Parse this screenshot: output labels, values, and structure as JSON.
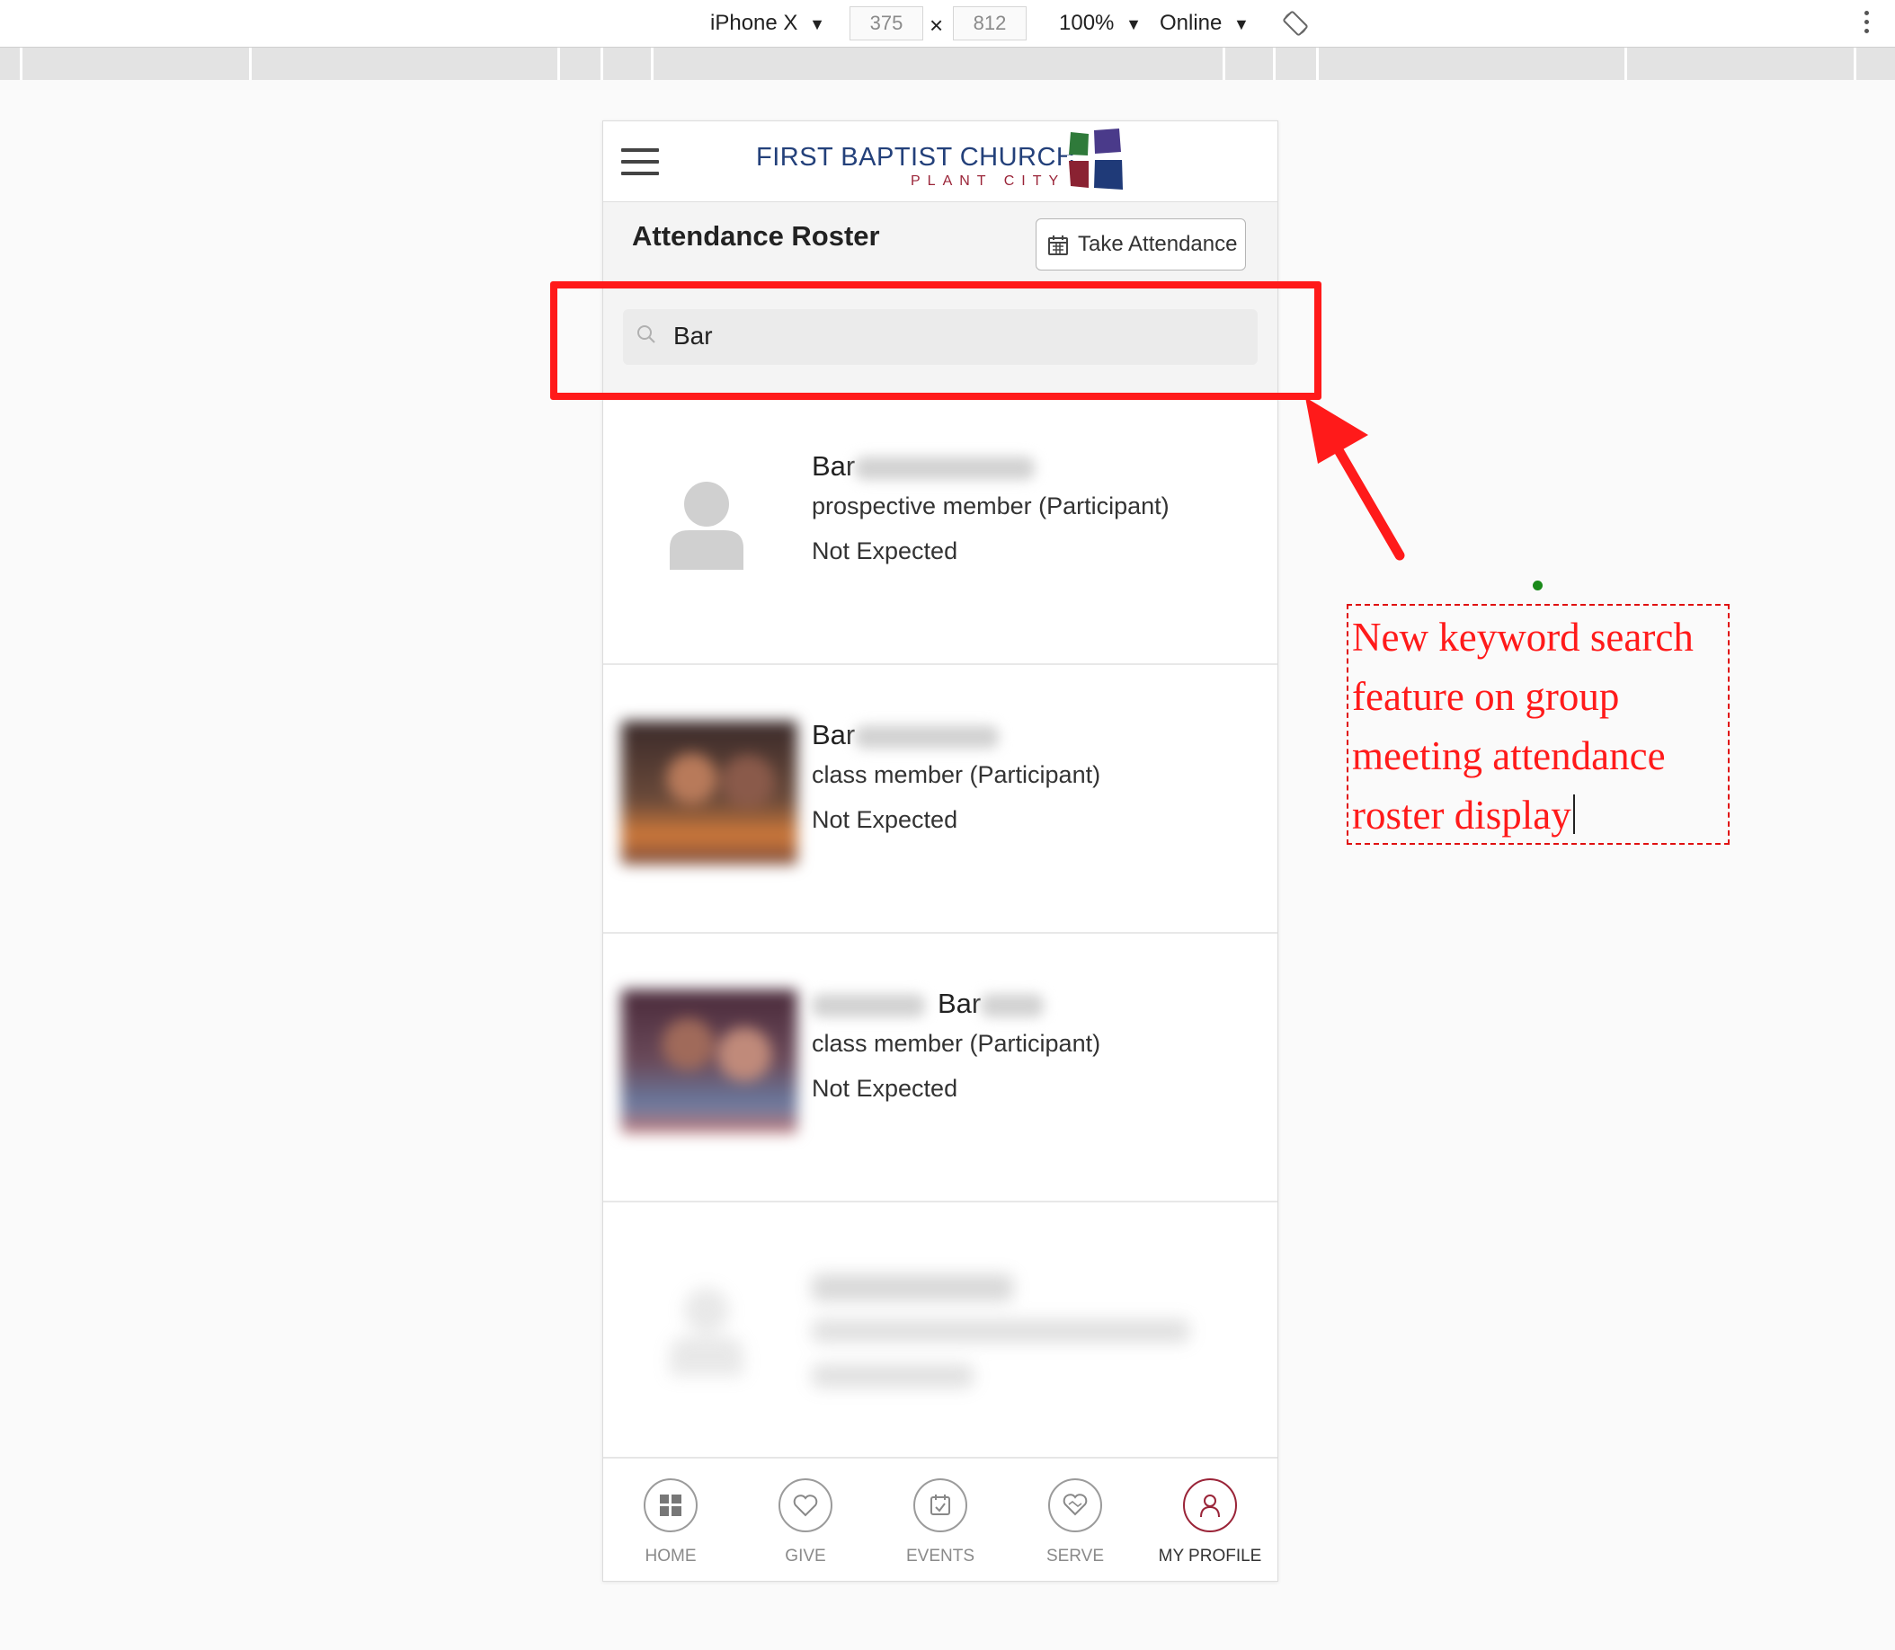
{
  "devtools": {
    "device": "iPhone X",
    "width": "375",
    "height": "812",
    "times": "×",
    "zoom": "100%",
    "network": "Online",
    "dropdown_glyph": "▼"
  },
  "app": {
    "brand_name": "FIRST BAPTIST CHURCH",
    "brand_sub": "PLANT CITY",
    "page_title": "Attendance Roster",
    "take_attendance_label": "Take Attendance",
    "search": {
      "value": "Bar"
    },
    "roster": [
      {
        "name": "Bar",
        "name_prefix": "",
        "role": "prospective member (Participant)",
        "status": "Not Expected",
        "avatar": "default-avatar"
      },
      {
        "name": "Bar",
        "name_prefix": "",
        "role": "class member (Participant)",
        "status": "Not Expected",
        "avatar": "photo"
      },
      {
        "name": "Bar",
        "name_prefix": "",
        "role": "class member (Participant)",
        "status": "Not Expected",
        "avatar": "photo"
      }
    ],
    "nav": [
      {
        "label": "HOME",
        "icon": "home-icon",
        "active": false
      },
      {
        "label": "GIVE",
        "icon": "heart-icon",
        "active": false
      },
      {
        "label": "EVENTS",
        "icon": "calendar-icon",
        "active": false
      },
      {
        "label": "SERVE",
        "icon": "handshake-icon",
        "active": false
      },
      {
        "label": "MY PROFILE",
        "icon": "person-icon",
        "active": true
      }
    ]
  },
  "annotation": {
    "text": "New keyword search feature on group meeting attendance roster display",
    "color": "#ff1a1a"
  },
  "colors": {
    "brand_blue": "#23407a",
    "brand_red": "#9a2438",
    "highlight_red": "#ff1a1a"
  }
}
